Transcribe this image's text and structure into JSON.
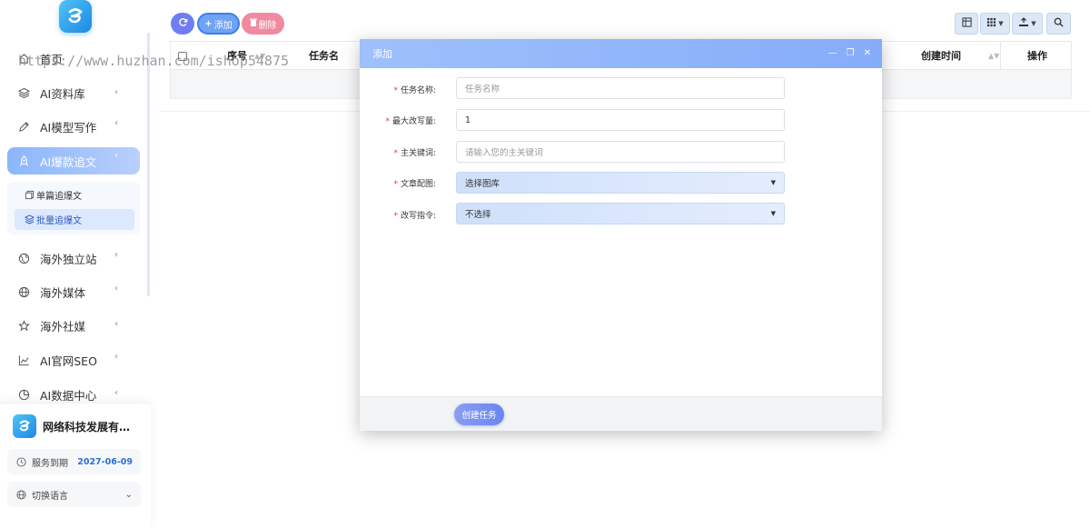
{
  "sidebar": {
    "logo_text": "e",
    "menu": [
      {
        "label": "首页",
        "icon": "home-icon"
      },
      {
        "label": "AI资料库",
        "icon": "layers-icon"
      },
      {
        "label": "AI模型写作",
        "icon": "pen-icon"
      },
      {
        "label": "AI爆款追文",
        "icon": "rocket-icon",
        "active": true
      },
      {
        "label": "海外独立站",
        "icon": "globe-icon"
      },
      {
        "label": "海外媒体",
        "icon": "globe-grid-icon"
      },
      {
        "label": "海外社媒",
        "icon": "star-icon"
      },
      {
        "label": "AI官网SEO",
        "icon": "chart-line-icon"
      },
      {
        "label": "AI数据中心",
        "icon": "pie-chart-icon"
      }
    ],
    "submenu": [
      {
        "label": "单篇追爆文"
      },
      {
        "label": "批量追爆文",
        "active": true
      }
    ],
    "company": {
      "logo_text": "e",
      "name": "网络科技发展有限...",
      "service_label": "服务到期",
      "service_date": "2027-06-09",
      "language_label": "切换语言"
    }
  },
  "toolbar": {
    "add_label": "添加",
    "delete_label": "删除"
  },
  "table": {
    "columns": {
      "index": "序号",
      "task_name": "任务名",
      "created_time": "创建时间",
      "actions": "操作"
    }
  },
  "watermark": "https://www.huzhan.com/ishop54875",
  "modal": {
    "title": "添加",
    "fields": [
      {
        "label": "任务名称:",
        "placeholder": "任务名称",
        "value": ""
      },
      {
        "label": "最大改写量:",
        "value": "1"
      },
      {
        "label": "主关键词:",
        "placeholder": "请输入您的主关键词",
        "value": ""
      },
      {
        "label": "文章配图:",
        "value": "选择图库",
        "type": "select"
      },
      {
        "label": "改写指令:",
        "value": "不选择",
        "type": "select"
      }
    ],
    "submit_label": "创建任务"
  },
  "colors": {
    "accent": "#86acf9",
    "menu_active": "#9fc0fb",
    "delete": "#f08aa0",
    "required": "#e4393c",
    "date": "#2e6fd6"
  }
}
